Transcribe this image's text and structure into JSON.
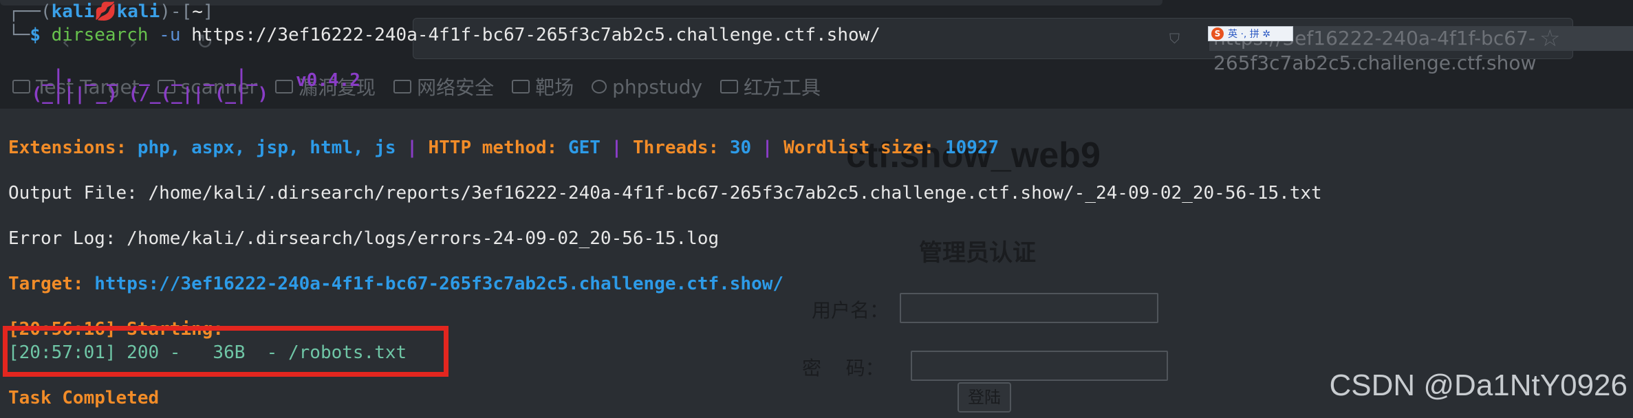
{
  "browser": {
    "url_text": "https://3ef16222-240a-4f1f-bc67-265f3c7ab2c5.challenge.ctf.show",
    "star_icon": "star-icon",
    "nav_icons": "‹ › ↻",
    "bookmarks": [
      {
        "label": "Test Target"
      },
      {
        "label": "scanner"
      },
      {
        "label": "漏洞复现"
      },
      {
        "label": "网络安全"
      },
      {
        "label": "靶场"
      },
      {
        "label": "phpstudy"
      },
      {
        "label": "红方工具"
      }
    ],
    "ime": {
      "logo": "S",
      "text": "英 ·, 拼 ✲"
    },
    "page": {
      "title": "ctf.show_web9",
      "heading": "管理员认证",
      "username_label": "用户名：",
      "password_label": "密    码：",
      "login_button": "登陆"
    }
  },
  "terminal": {
    "prompt_user": "kali",
    "prompt_host": "kali",
    "prompt_dir": "~",
    "command": "dirsearch",
    "flag": "-u",
    "url_arg": "https://3ef16222-240a-4f1f-bc67-265f3c7ab2c5.challenge.ctf.show/",
    "banner_line1": "  _|. _ _  _  _  _ _|_",
    "banner_line2": " (_||| _) (/_(_|| (_| )",
    "version": "v0.4.2",
    "extensions_label": "Extensions:",
    "extensions_value": "php, aspx, jsp, html, js",
    "method_label": "HTTP method:",
    "method_value": "GET",
    "threads_label": "Threads:",
    "threads_value": "30",
    "wordlist_label": "Wordlist size:",
    "wordlist_value": "10927",
    "separator": "|",
    "output_file": "Output File: /home/kali/.dirsearch/reports/3ef16222-240a-4f1f-bc67-265f3c7ab2c5.challenge.ctf.show/-_24-09-02_20-56-15.txt",
    "error_log": "Error Log: /home/kali/.dirsearch/logs/errors-24-09-02_20-56-15.log",
    "target_label": "Target:",
    "target_value": "https://3ef16222-240a-4f1f-bc67-265f3c7ab2c5.challenge.ctf.show/",
    "starting": "[20:56:16] Starting:",
    "result_line": "[20:57:01] 200 -   36B  - /robots.txt",
    "task_completed": "Task Completed"
  },
  "watermark": "CSDN @Da1NtY0926",
  "colors": {
    "orange": "#f28c28",
    "blue": "#2d9be8",
    "highlight_box": "#e3261f",
    "result_green": "#6fc6a6"
  }
}
